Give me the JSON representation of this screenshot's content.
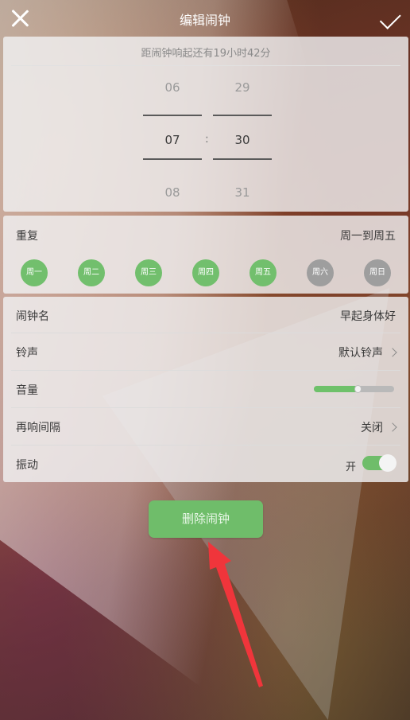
{
  "header": {
    "title": "编辑闹钟"
  },
  "time_picker": {
    "countdown": "距闹钟响起还有19小时42分",
    "hours": {
      "prev": "06",
      "current": "07",
      "next": "08"
    },
    "minutes": {
      "prev": "29",
      "current": "30",
      "next": "31"
    },
    "separator": ":"
  },
  "repeat": {
    "label": "重复",
    "summary": "周一到周五",
    "days": [
      {
        "label": "周一",
        "selected": true
      },
      {
        "label": "周二",
        "selected": true
      },
      {
        "label": "周三",
        "selected": true
      },
      {
        "label": "周四",
        "selected": true
      },
      {
        "label": "周五",
        "selected": true
      },
      {
        "label": "周六",
        "selected": false
      },
      {
        "label": "周日",
        "selected": false
      }
    ]
  },
  "settings": {
    "alarm_name": {
      "label": "闹钟名",
      "value": "早起身体好"
    },
    "ringtone": {
      "label": "铃声",
      "value": "默认铃声"
    },
    "volume": {
      "label": "音量",
      "level": 0.54
    },
    "snooze": {
      "label": "再响间隔",
      "value": "关闭"
    },
    "vibrate": {
      "label": "振动",
      "value": "开",
      "on": true
    }
  },
  "delete_button": {
    "label": "删除闹钟"
  },
  "colors": {
    "accent_green": "#6fbd6a",
    "day_selected": "#72bf6d",
    "day_weekend": "#9e9e9e",
    "annotation_red": "#f0353b"
  }
}
